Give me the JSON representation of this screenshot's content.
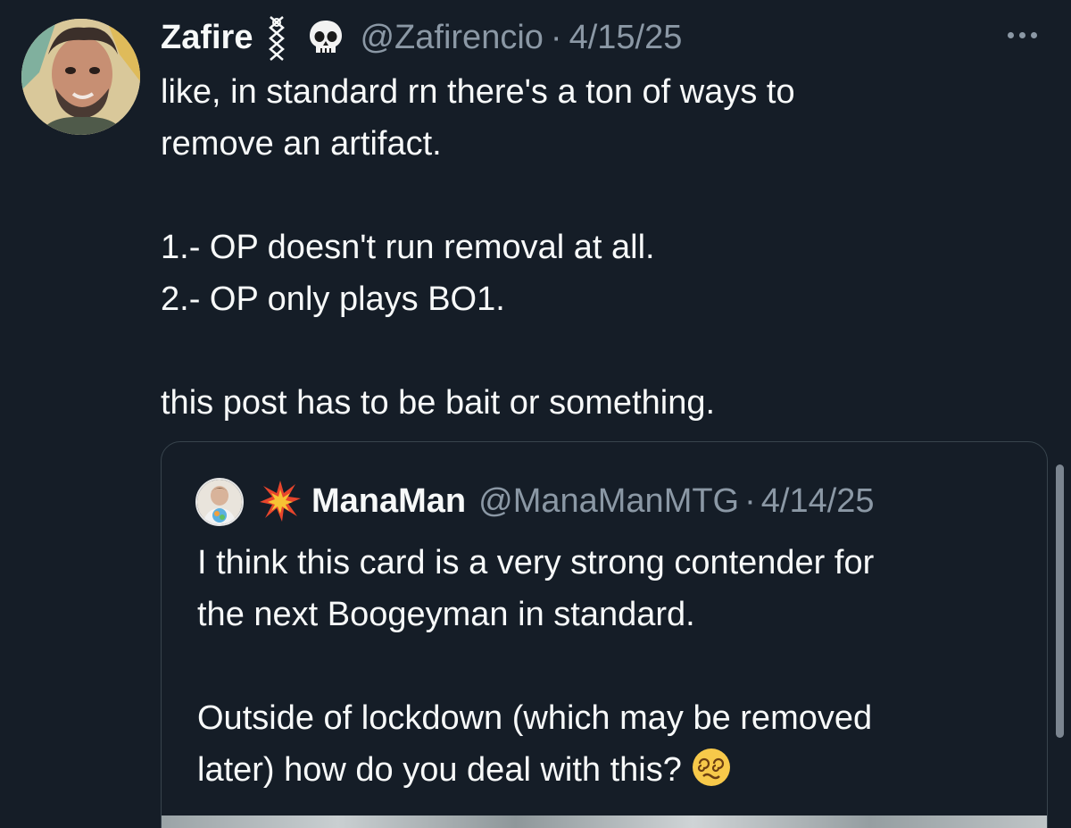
{
  "tweet": {
    "author": {
      "display_name": "Zafire",
      "handle": "@Zafirencio",
      "avatar": "bearded-man-avatar",
      "badges": [
        "rune-icon",
        "skull-icon"
      ]
    },
    "separator": "·",
    "timestamp": "4/15/25",
    "text": "like, in standard rn there's a ton of ways to\nremove an artifact.\n\n1.- OP doesn't run removal at all.\n2.- OP only plays BO1.\n\nthis post has to be bait or something."
  },
  "quote": {
    "author": {
      "display_name": "ManaMan",
      "handle": "@ManaManMTG",
      "avatar": "man-with-orb-avatar",
      "badge": "collision-burst-icon"
    },
    "separator": "·",
    "timestamp": "4/14/25",
    "text": "I think this card is a very strong contender for\nthe next Boogeyman in standard.\n\nOutside of lockdown (which may be removed\nlater) how do you deal with this?",
    "trailing_emoji": "dizzy-face-icon"
  },
  "icons": {
    "more": "more-options-icon"
  },
  "colors": {
    "background": "#151d27",
    "text": "#f7f9f9",
    "secondary_text": "#8b98a5",
    "border": "#38444d"
  }
}
